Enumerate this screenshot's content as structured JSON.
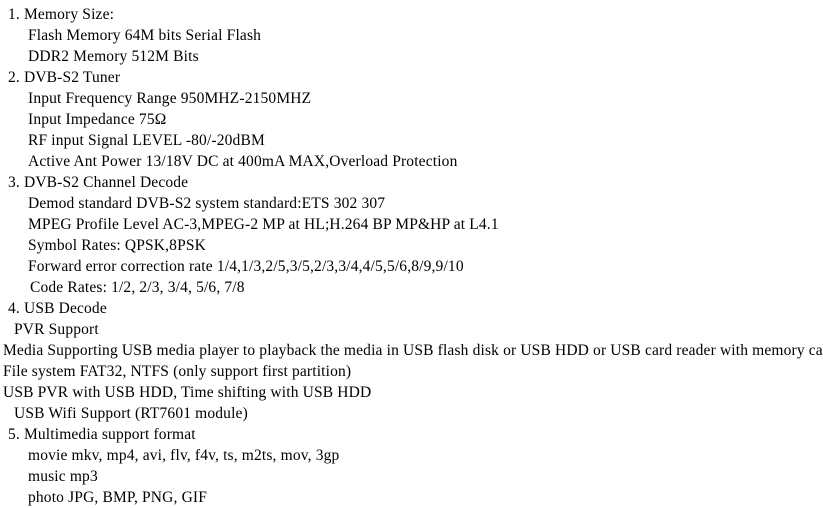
{
  "document": {
    "type": "specification-list",
    "text_color": "#000000",
    "background_color": "#ffffff",
    "lines": [
      {
        "text": "1. Memory Size:",
        "indent": "ind-num",
        "name": "spec-heading-memory-size"
      },
      {
        "text": "Flash Memory 64M bits Serial Flash",
        "indent": "ind-sub",
        "name": "spec-detail-flash-memory"
      },
      {
        "text": "DDR2 Memory 512M Bits",
        "indent": "ind-sub",
        "name": "spec-detail-ddr2-memory"
      },
      {
        "text": "2. DVB-S2 Tuner",
        "indent": "ind-num",
        "name": "spec-heading-dvb-s2-tuner"
      },
      {
        "text": "Input Frequency Range 950MHZ-2150MHZ",
        "indent": "ind-sub",
        "name": "spec-detail-input-frequency-range"
      },
      {
        "text": "Input Impedance 75Ω",
        "indent": "ind-sub",
        "name": "spec-detail-input-impedance"
      },
      {
        "text": "RF input Signal LEVEL -80/-20dBM",
        "indent": "ind-sub",
        "name": "spec-detail-rf-input-signal-level"
      },
      {
        "text": "Active Ant Power 13/18V DC at 400mA MAX,Overload Protection",
        "indent": "ind-sub",
        "name": "spec-detail-active-ant-power"
      },
      {
        "text": "3. DVB-S2 Channel Decode",
        "indent": "ind-num",
        "name": "spec-heading-dvb-s2-channel-decode"
      },
      {
        "text": "Demod standard DVB-S2 system standard:ETS 302 307",
        "indent": "ind-sub",
        "name": "spec-detail-demod-standard"
      },
      {
        "text": "MPEG Profile Level AC-3,MPEG-2 MP at HL;H.264 BP MP&HP at L4.1",
        "indent": "ind-sub",
        "name": "spec-detail-mpeg-profile-level"
      },
      {
        "text": "Symbol Rates: QPSK,8PSK",
        "indent": "ind-sub",
        "name": "spec-detail-symbol-rates"
      },
      {
        "text": "Forward error correction rate 1/4,1/3,2/5,3/5,2/3,3/4,4/5,5/6,8/9,9/10",
        "indent": "ind-sub",
        "name": "spec-detail-forward-error-correction-rate"
      },
      {
        "text": "Code Rates: 1/2, 2/3, 3/4, 5/6, 7/8",
        "indent": "ind-sub2",
        "name": "spec-detail-code-rates"
      },
      {
        "text": "4. USB Decode",
        "indent": "ind-num",
        "name": "spec-heading-usb-decode"
      },
      {
        "text": "PVR Support",
        "indent": "ind-half",
        "name": "spec-detail-pvr-support"
      },
      {
        "text": "Media Supporting USB media player to playback the media in USB flash disk or USB HDD or USB card reader with memory card",
        "indent": "ind-flush",
        "name": "spec-detail-media-supporting"
      },
      {
        "text": "File system FAT32, NTFS (only support first partition)",
        "indent": "ind-flush",
        "name": "spec-detail-file-system"
      },
      {
        "text": "USB PVR with USB HDD, Time shifting with USB HDD",
        "indent": "ind-flush",
        "name": "spec-detail-usb-pvr"
      },
      {
        "text": "USB Wifi Support (RT7601 module)",
        "indent": "ind-half",
        "name": "spec-detail-usb-wifi-support"
      },
      {
        "text": "5. Multimedia support format",
        "indent": "ind-num",
        "name": "spec-heading-multimedia-support-format"
      },
      {
        "text": "movie mkv, mp4, avi, flv, f4v, ts, m2ts, mov, 3gp",
        "indent": "ind-sub",
        "name": "spec-detail-movie-formats"
      },
      {
        "text": "music mp3",
        "indent": "ind-sub",
        "name": "spec-detail-music-formats"
      },
      {
        "text": "photo JPG, BMP, PNG, GIF",
        "indent": "ind-sub",
        "name": "spec-detail-photo-formats"
      }
    ]
  }
}
